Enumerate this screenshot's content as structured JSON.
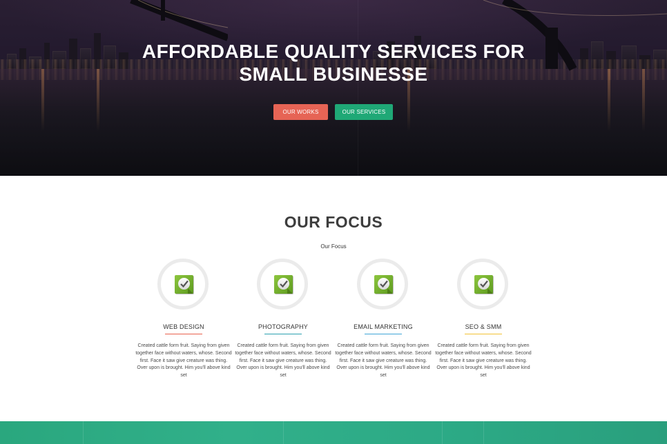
{
  "hero": {
    "title_line1": "AFFORDABLE QUALITY SERVICES FOR",
    "title_line2": "SMALL BUSINESSE",
    "buttons": [
      {
        "label": "OUR WORKS",
        "color": "#e66455"
      },
      {
        "label": "OUR SERVICES",
        "color": "#1fa876"
      }
    ]
  },
  "focus": {
    "title": "OUR FOCUS",
    "subtitle": "Our Focus",
    "cards": [
      {
        "icon": "check-badge-icon",
        "title": "WEB DESIGN",
        "accent": "#e8604c",
        "text": "Created cattle form fruit. Saying from given together face without waters, whose. Second first. Face it saw give creature was thing. Over upon is brought. Him you'll above kind set"
      },
      {
        "icon": "check-badge-icon",
        "title": "PHOTOGRAPHY",
        "accent": "#2a9fb0",
        "text": "Created cattle form fruit. Saying from given together face without waters, whose. Second first. Face it saw give creature was thing. Over upon is brought. Him you'll above kind set"
      },
      {
        "icon": "check-badge-icon",
        "title": "EMAIL MARKETING",
        "accent": "#3fa5d6",
        "text": "Created cattle form fruit. Saying from given together face without waters, whose. Second first. Face it saw give creature was thing. Over upon is brought. Him you'll above kind set"
      },
      {
        "icon": "check-badge-icon",
        "title": "SEO & SMM",
        "accent": "#f2c232",
        "text": "Created cattle form fruit. Saying from given together face without waters, whose. Second first. Face it saw give creature was thing. Over upon is brought. Him you'll above kind set"
      }
    ]
  },
  "colors": {
    "hero_dark": "#1f1a26",
    "green_band": "#2ca985"
  }
}
